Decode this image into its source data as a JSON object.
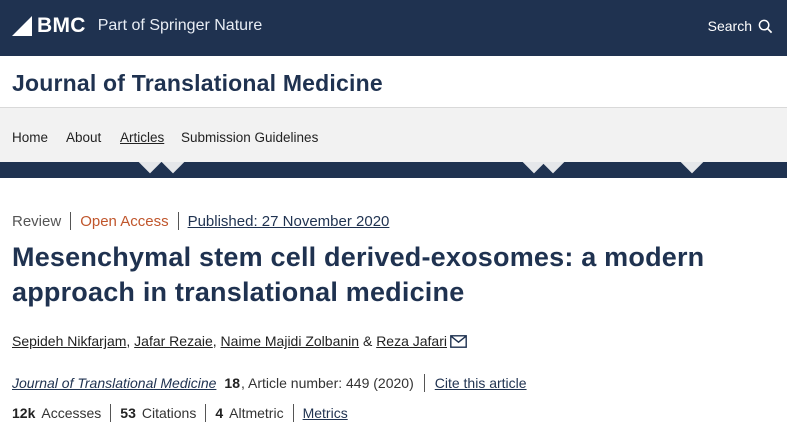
{
  "header": {
    "brand": "BMC",
    "tagline": "Part of Springer Nature",
    "search_label": "Search",
    "search_icon": "search-icon"
  },
  "journal": {
    "title": "Journal of Translational Medicine"
  },
  "nav": {
    "items": [
      {
        "label": "Home"
      },
      {
        "label": "About"
      },
      {
        "label": "Articles"
      },
      {
        "label": "Submission Guidelines"
      }
    ],
    "active": "Articles"
  },
  "article": {
    "type": "Review",
    "access": "Open Access",
    "published": "Published: 27 November 2020",
    "title": "Mesenchymal stem cell derived-exosomes: a modern approach in translational medicine",
    "authors": [
      {
        "name": "Sepideh Nikfarjam",
        "after": ", "
      },
      {
        "name": "Jafar Rezaie",
        "after": ", "
      },
      {
        "name": "Naime Majidi Zolbanin",
        "after": " & "
      },
      {
        "name": "Reza Jafari",
        "after": ""
      }
    ],
    "citation": {
      "journal": "Journal of Translational Medicine",
      "volume": "18",
      "details": ", Article number: 449 (2020)",
      "cite_link": "Cite this article"
    },
    "metrics": {
      "accesses_value": "12k",
      "accesses_label": "Accesses",
      "citations_value": "53",
      "citations_label": "Citations",
      "altmetric_value": "4",
      "altmetric_label": "Altmetric",
      "metrics_link": "Metrics"
    }
  },
  "colors": {
    "brand_navy": "#1f3250",
    "open_access": "#c0562c",
    "nav_bg": "#f2f2f2"
  }
}
